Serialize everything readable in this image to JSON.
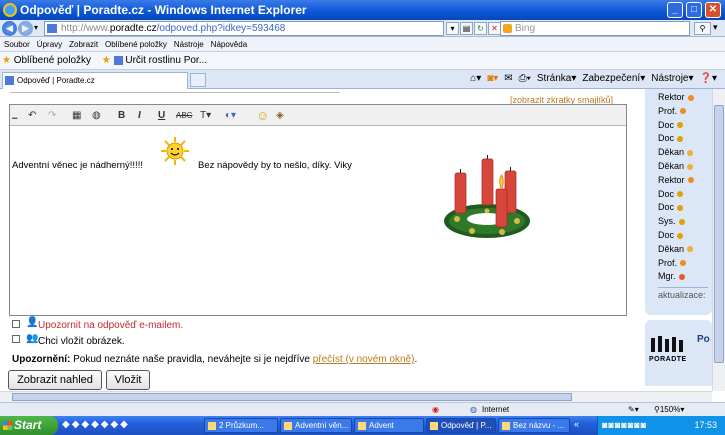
{
  "window": {
    "title": "Odpověď | Poradte.cz - Windows Internet Explorer",
    "minimize": "_",
    "maximize": "□",
    "close": "✕"
  },
  "address": {
    "url_prefix": "http://www.",
    "url_host": "poradte.cz",
    "url_path": "/odpoved.php?idkey=593468",
    "search_placeholder": "Bing"
  },
  "menu": [
    "Soubor",
    "Úpravy",
    "Zobrazit",
    "Oblíbené položky",
    "Nástroje",
    "Nápověda"
  ],
  "favorites": {
    "label": "Oblíbené položky",
    "item": "Určit rostlinu",
    "more": "Por..."
  },
  "tab": {
    "title": "Odpověď | Poradte.cz"
  },
  "command_bar": {
    "page": "Stránka",
    "security": "Zabezpečení",
    "tools": "Nástroje"
  },
  "editor": {
    "smileys_link": "[zobrazit zkratky smajlíků]",
    "text_part1": "Adventní věnec je nádherný!!!!!",
    "text_part2": "Bez nápovědy by to nešlo, díky. Viky"
  },
  "sidebar": {
    "items": [
      {
        "label": "Rektor",
        "color": "#f08a1c"
      },
      {
        "label": "Prof.",
        "color": "#f08a1c"
      },
      {
        "label": "Doc",
        "color": "#e0a000"
      },
      {
        "label": "Doc",
        "color": "#e0a000"
      },
      {
        "label": "Děkan",
        "color": "#f0b030"
      },
      {
        "label": "Děkan",
        "color": "#f0b030"
      },
      {
        "label": "Rektor",
        "color": "#f08a1c"
      },
      {
        "label": "Doc",
        "color": "#e0a000"
      },
      {
        "label": "Doc",
        "color": "#e0a000"
      },
      {
        "label": "Sys.",
        "color": "#e0a000"
      },
      {
        "label": "Doc",
        "color": "#e0a000"
      },
      {
        "label": "Děkan",
        "color": "#f0b030"
      },
      {
        "label": "Prof.",
        "color": "#f08a1c"
      },
      {
        "label": "Mgr.",
        "color": "#e55a2a"
      }
    ],
    "update_label": "aktualizace:",
    "logo_text": "PORADTE",
    "more": "Po"
  },
  "form": {
    "notify_label": "Upozornit na odpověď e-mailem.",
    "image_label": "Chci vložit obrázek.",
    "warning_bold": "Upozornění:",
    "warning_text": "Pokud neznáte naše pravidla, neváhejte si je nejdříve",
    "warning_link": "přečíst (v novém okně)",
    "warning_end": ".",
    "preview_button": "Zobrazit nahled",
    "submit_button": "Vložit",
    "link_color": "#c07a20",
    "notify_color": "#c0282c"
  },
  "status": {
    "zone": "Internet",
    "zoom": "150%"
  },
  "taskbar": {
    "start": "Start",
    "tasks": [
      "2 Průzkum...",
      "Adventní věn...",
      "Advent",
      "Odpověď | P...",
      "Bez názvu - ..."
    ],
    "clock": "17:53"
  }
}
